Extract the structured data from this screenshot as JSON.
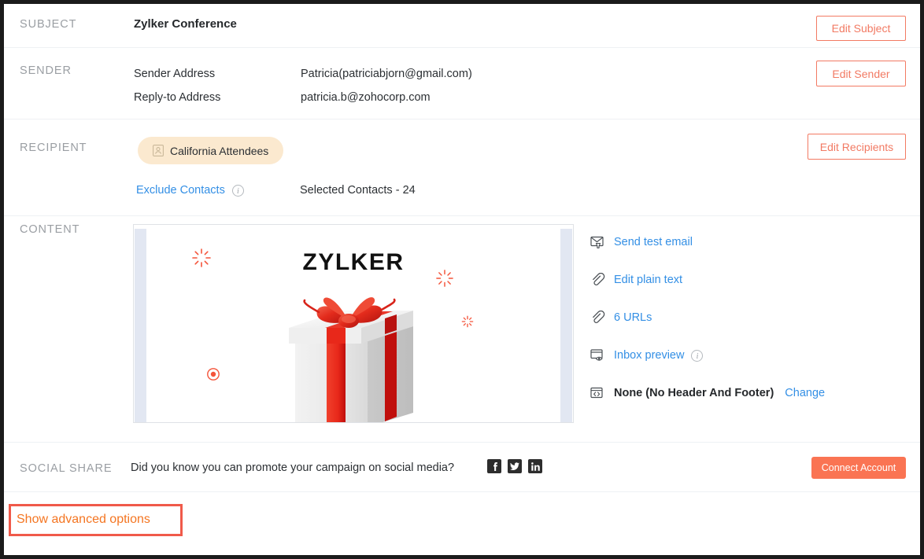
{
  "sections": {
    "subject": {
      "label": "SUBJECT",
      "value": "Zylker Conference",
      "edit_button": "Edit Subject"
    },
    "sender": {
      "label": "SENDER",
      "sender_address_label": "Sender Address",
      "sender_address_value": "Patricia(patriciabjorn@gmail.com)",
      "reply_to_label": "Reply-to Address",
      "reply_to_value": "patricia.b@zohocorp.com",
      "edit_button": "Edit Sender"
    },
    "recipient": {
      "label": "RECIPIENT",
      "chip_label": "California Attendees",
      "chip_icon": "contact-card-icon",
      "exclude_contacts_link": "Exclude Contacts",
      "exclude_info_icon": "info-icon",
      "selected_contacts": "Selected Contacts - 24",
      "edit_button": "Edit Recipients"
    },
    "content": {
      "label": "CONTENT",
      "preview": {
        "heading": "ZYLKER",
        "artwork": "gift-box-illustration"
      },
      "links": [
        {
          "icon": "test-email-icon",
          "label": "Send test email",
          "style": "link"
        },
        {
          "icon": "paperclip-icon",
          "label": "Edit plain text",
          "style": "link"
        },
        {
          "icon": "paperclip-icon",
          "label": "6 URLs",
          "style": "link"
        },
        {
          "icon": "inbox-preview-icon",
          "label": "Inbox preview",
          "style": "link",
          "info_icon": "info-icon"
        },
        {
          "icon": "code-brackets-icon",
          "label": "None (No Header And Footer)",
          "style": "dark",
          "action_label": "Change"
        }
      ]
    },
    "social_share": {
      "label": "SOCIAL SHARE",
      "text": "Did you know you can promote your campaign on social media?",
      "icons": [
        "facebook-icon",
        "twitter-icon",
        "linkedin-icon"
      ],
      "connect_button": "Connect Account"
    },
    "footer": {
      "advanced_options_link": "Show advanced options"
    }
  },
  "colors": {
    "accent_orange": "#f47521",
    "button_orange": "#fa7453",
    "outline_orange": "#f27a63",
    "link_blue": "#338fe5",
    "chip_bg": "#fbe9cf",
    "highlight_red": "#f05a4a",
    "label_gray": "#9a9ea3"
  }
}
